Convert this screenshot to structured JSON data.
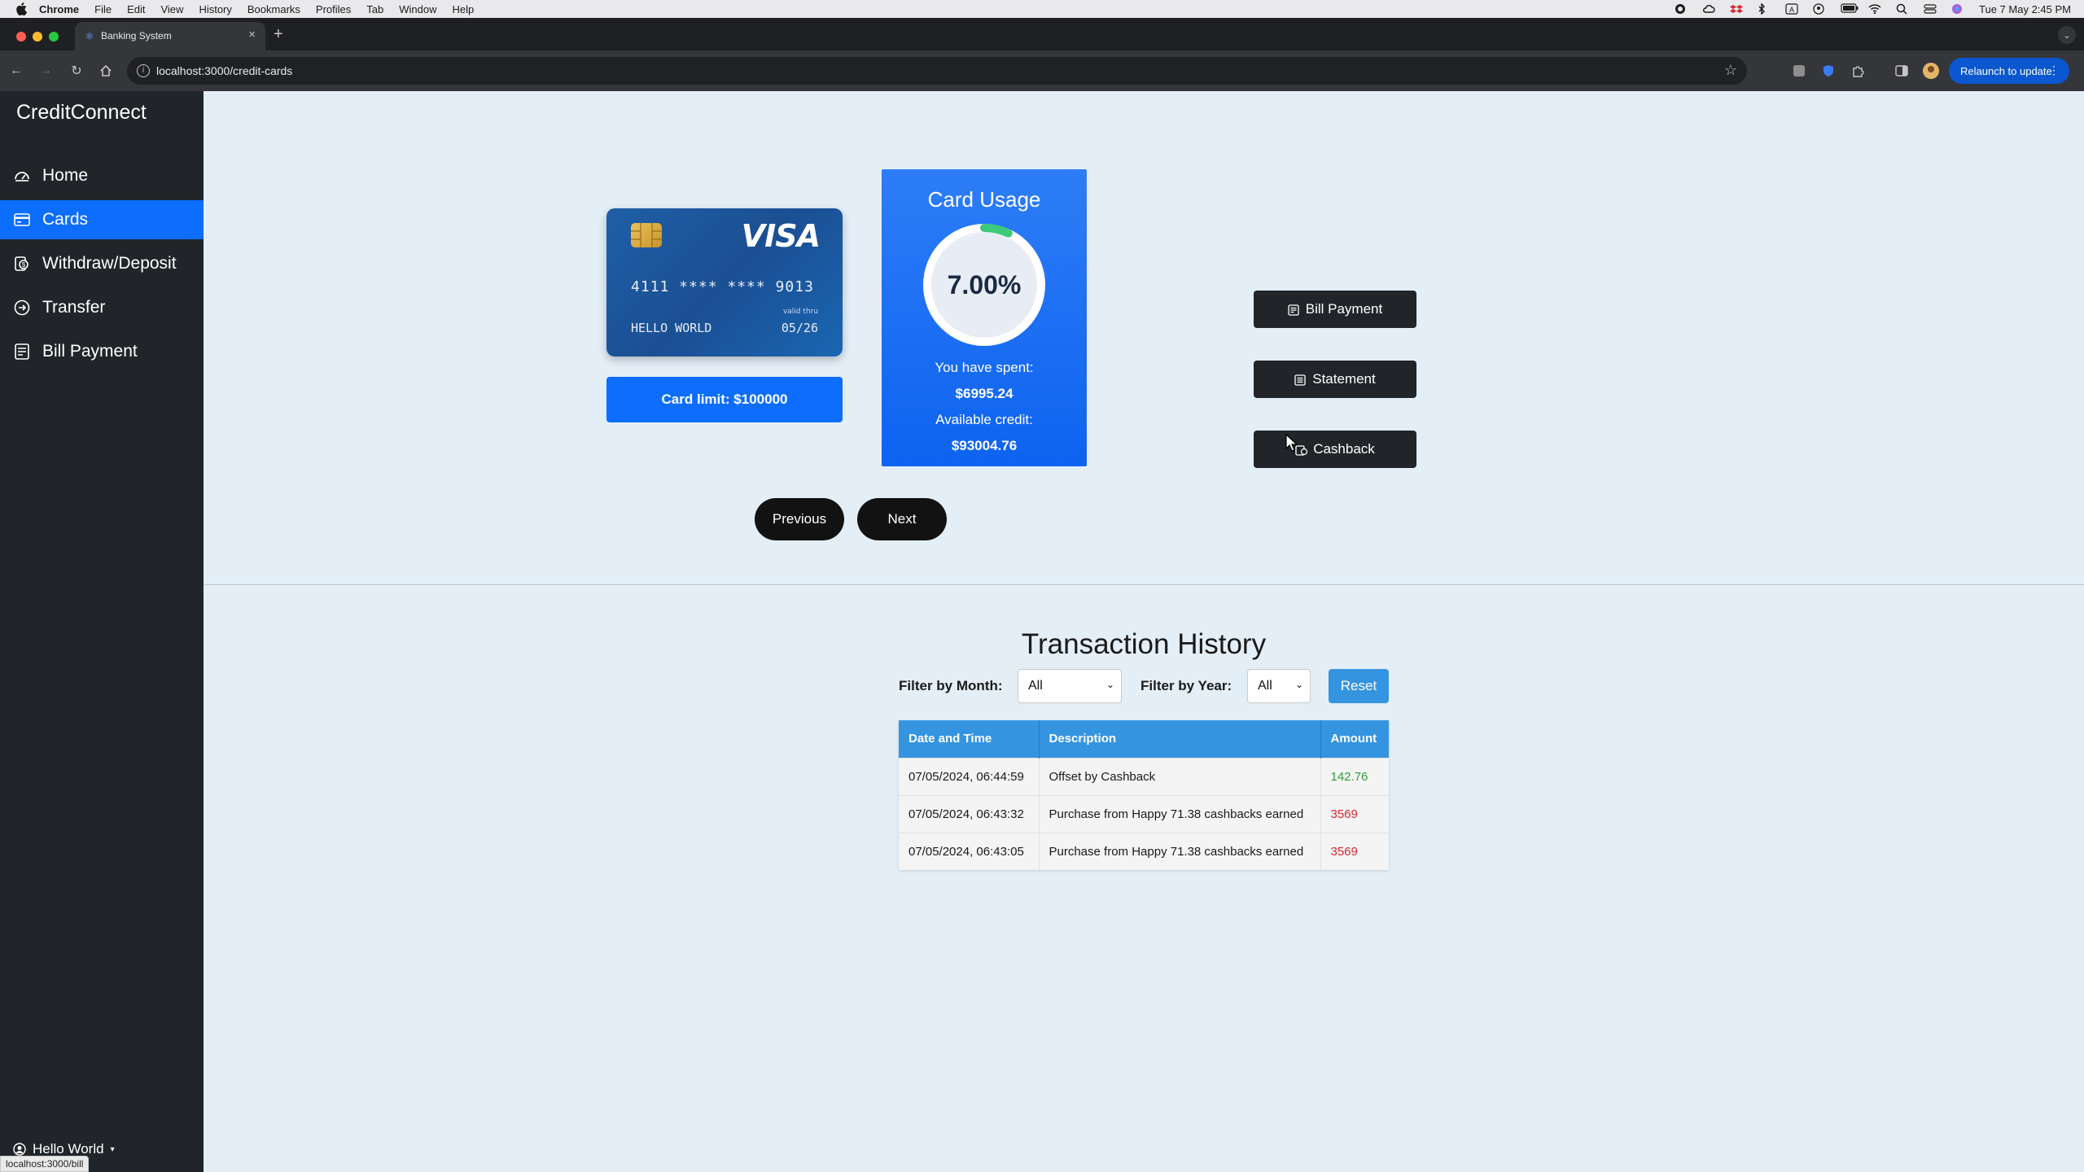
{
  "menubar": {
    "app": "Chrome",
    "items": [
      "File",
      "Edit",
      "View",
      "History",
      "Bookmarks",
      "Profiles",
      "Tab",
      "Window",
      "Help"
    ],
    "clock": "Tue 7 May  2:45 PM"
  },
  "browser": {
    "tab_title": "Banking System",
    "url": "localhost:3000/credit-cards",
    "relaunch_label": "Relaunch to update"
  },
  "sidebar": {
    "brand": "CreditConnect",
    "items": [
      {
        "label": "Home",
        "icon": "dashboard-icon"
      },
      {
        "label": "Cards",
        "icon": "credit-card-icon",
        "active": true
      },
      {
        "label": "Withdraw/Deposit",
        "icon": "cash-icon"
      },
      {
        "label": "Transfer",
        "icon": "arrow-right-circle-icon"
      },
      {
        "label": "Bill Payment",
        "icon": "receipt-icon"
      }
    ],
    "user": "Hello World",
    "status_url": "localhost:3000/bill"
  },
  "card": {
    "brand": "VISA",
    "number": "4111 **** **** 9013",
    "valid_thru_label": "valid thru",
    "holder": "HELLO WORLD",
    "expiry": "05/26",
    "limit_label": "Card limit: $100000"
  },
  "usage": {
    "title": "Card Usage",
    "percent_text": "7.00%",
    "percent_value": 7.0,
    "spent_label": "You have spent:",
    "spent_value": "$6995.24",
    "available_label": "Available credit:",
    "available_value": "$93004.76",
    "ring_color": "#3cc97a",
    "ring_track_color": "#ffffff"
  },
  "actions": {
    "bill_payment": "Bill Payment",
    "statement": "Statement",
    "cashback": "Cashback"
  },
  "pager": {
    "previous": "Previous",
    "next": "Next"
  },
  "transactions": {
    "title": "Transaction History",
    "filter_month_label": "Filter by Month:",
    "filter_month_value": "All",
    "filter_year_label": "Filter by Year:",
    "filter_year_value": "All",
    "reset_label": "Reset",
    "columns": [
      "Date and Time",
      "Description",
      "Amount"
    ],
    "rows": [
      {
        "date": "07/05/2024, 06:44:59",
        "description": "Offset by Cashback",
        "amount": "142.76",
        "type": "credit"
      },
      {
        "date": "07/05/2024, 06:43:32",
        "description": "Purchase from Happy 71.38 cashbacks earned",
        "amount": "3569",
        "type": "debit"
      },
      {
        "date": "07/05/2024, 06:43:05",
        "description": "Purchase from Happy 71.38 cashbacks earned",
        "amount": "3569",
        "type": "debit"
      }
    ]
  },
  "colors": {
    "primary": "#0d6efd",
    "sidebar_bg": "#212529",
    "table_header": "#3594e0",
    "credit": "#2e9c3a",
    "debit": "#d6282f"
  }
}
